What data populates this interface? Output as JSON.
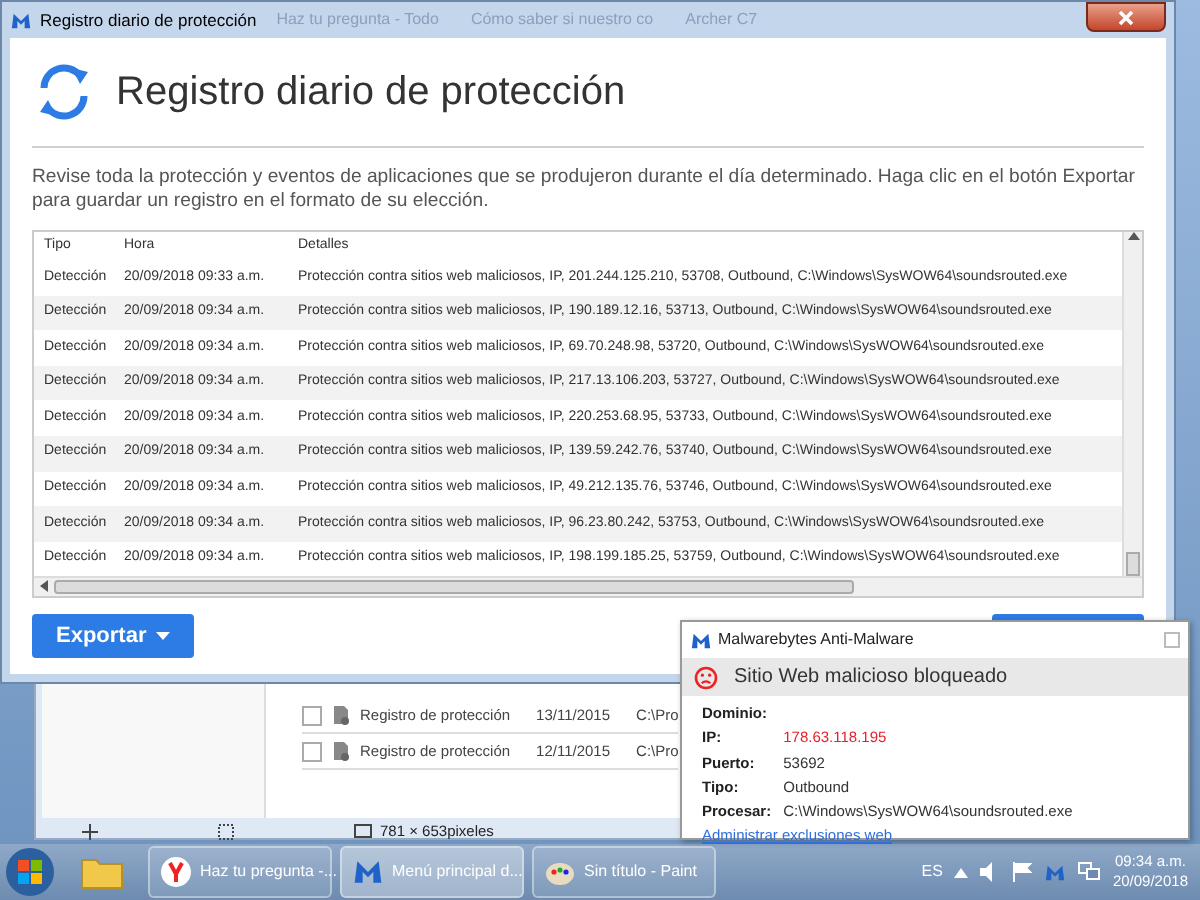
{
  "window": {
    "title": "Registro diario de protección",
    "background_tabs": [
      "Haz tu pregunta - Todo",
      "Cómo saber si nuestro co",
      "Archer C7"
    ]
  },
  "header": {
    "title": "Registro diario de protección"
  },
  "description": "Revise toda la protección y eventos de aplicaciones que se produjeron durante el día determinado. Haga clic en el botón Exportar para guardar un registro en el formato de su elección.",
  "table": {
    "columns": [
      "Tipo",
      "Hora",
      "Detalles"
    ],
    "rows": [
      {
        "tipo": "Detección",
        "hora": "20/09/2018 09:33 a.m.",
        "detalles": "Protección contra sitios web maliciosos, IP, 201.244.125.210, 53708, Outbound, C:\\Windows\\SysWOW64\\soundsrouted.exe"
      },
      {
        "tipo": "Detección",
        "hora": "20/09/2018 09:34 a.m.",
        "detalles": "Protección contra sitios web maliciosos, IP, 190.189.12.16, 53713, Outbound, C:\\Windows\\SysWOW64\\soundsrouted.exe"
      },
      {
        "tipo": "Detección",
        "hora": "20/09/2018 09:34 a.m.",
        "detalles": "Protección contra sitios web maliciosos, IP, 69.70.248.98, 53720, Outbound, C:\\Windows\\SysWOW64\\soundsrouted.exe"
      },
      {
        "tipo": "Detección",
        "hora": "20/09/2018 09:34 a.m.",
        "detalles": "Protección contra sitios web maliciosos, IP, 217.13.106.203, 53727, Outbound, C:\\Windows\\SysWOW64\\soundsrouted.exe"
      },
      {
        "tipo": "Detección",
        "hora": "20/09/2018 09:34 a.m.",
        "detalles": "Protección contra sitios web maliciosos, IP, 220.253.68.95, 53733, Outbound, C:\\Windows\\SysWOW64\\soundsrouted.exe"
      },
      {
        "tipo": "Detección",
        "hora": "20/09/2018 09:34 a.m.",
        "detalles": "Protección contra sitios web maliciosos, IP, 139.59.242.76, 53740, Outbound, C:\\Windows\\SysWOW64\\soundsrouted.exe"
      },
      {
        "tipo": "Detección",
        "hora": "20/09/2018 09:34 a.m.",
        "detalles": "Protección contra sitios web maliciosos, IP, 49.212.135.76, 53746, Outbound, C:\\Windows\\SysWOW64\\soundsrouted.exe"
      },
      {
        "tipo": "Detección",
        "hora": "20/09/2018 09:34 a.m.",
        "detalles": "Protección contra sitios web maliciosos, IP, 96.23.80.242, 53753, Outbound, C:\\Windows\\SysWOW64\\soundsrouted.exe"
      },
      {
        "tipo": "Detección",
        "hora": "20/09/2018 09:34 a.m.",
        "detalles": "Protección contra sitios web maliciosos, IP, 198.199.185.25, 53759, Outbound, C:\\Windows\\SysWOW64\\soundsrouted.exe"
      }
    ]
  },
  "export_button": {
    "label": "Exportar"
  },
  "background_window": {
    "rows": [
      {
        "checked": false,
        "name": "Registro de protección",
        "date": "13/11/2015",
        "path": "C:\\Pro"
      },
      {
        "checked": false,
        "name": "Registro de protección",
        "date": "12/11/2015",
        "path": "C:\\Pro"
      }
    ],
    "status_bar": {
      "dimensions": "781 × 653pixeles"
    }
  },
  "notification": {
    "app": "Malwarebytes Anti-Malware",
    "title": "Sitio Web malicioso bloqueado",
    "fields": [
      {
        "label": "Dominio:"
      },
      {
        "label": "IP:",
        "value": "178.63.118.195",
        "highlight": true
      },
      {
        "label": "Puerto:",
        "value": "53692",
        "highlight": false
      },
      {
        "label": "Tipo:",
        "value": "Outbound",
        "highlight": false
      },
      {
        "label": "Procesar:",
        "value": "C:\\Windows\\SysWOW64\\soundsrouted.exe",
        "highlight": false
      }
    ],
    "link": "Administrar exclusiones web"
  },
  "taskbar": {
    "items": [
      {
        "kind": "browser",
        "label": "Haz tu pregunta -...",
        "selected": false
      },
      {
        "kind": "antimalware",
        "label": "Menú principal d...",
        "selected": true
      },
      {
        "kind": "paint",
        "label": "Sin título - Paint",
        "selected": false
      }
    ],
    "language": "ES",
    "time": "09:34 a.m.",
    "date": "20/09/2018"
  }
}
